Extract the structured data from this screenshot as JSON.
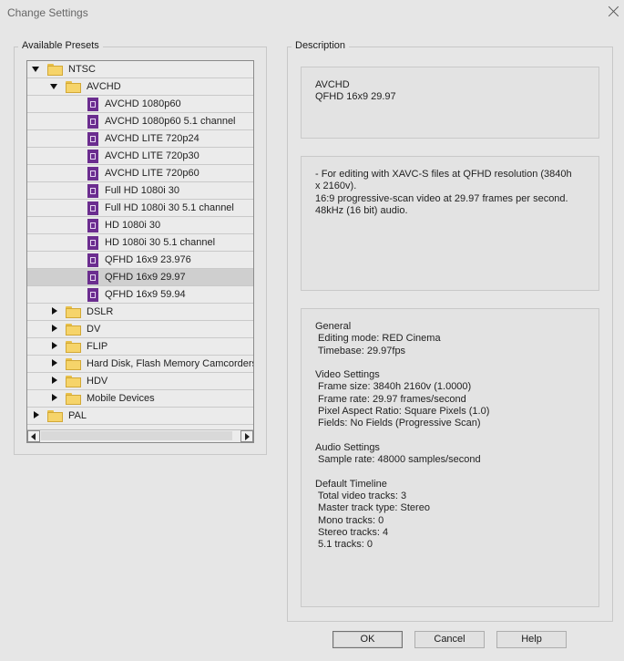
{
  "window": {
    "title": "Change Settings",
    "close_icon": "close-icon"
  },
  "presets_panel": {
    "label": "Available Presets",
    "tree": [
      {
        "label": "NTSC",
        "type": "folder",
        "arrow": "down",
        "indent": 0,
        "selected": false
      },
      {
        "label": "AVCHD",
        "type": "folder",
        "arrow": "down",
        "indent": 1,
        "selected": false
      },
      {
        "label": "AVCHD 1080p60",
        "type": "preset",
        "indent": 2,
        "selected": false
      },
      {
        "label": "AVCHD 1080p60 5.1 channel",
        "type": "preset",
        "indent": 2,
        "selected": false
      },
      {
        "label": "AVCHD LITE 720p24",
        "type": "preset",
        "indent": 2,
        "selected": false
      },
      {
        "label": "AVCHD LITE 720p30",
        "type": "preset",
        "indent": 2,
        "selected": false
      },
      {
        "label": "AVCHD LITE 720p60",
        "type": "preset",
        "indent": 2,
        "selected": false
      },
      {
        "label": "Full HD 1080i 30",
        "type": "preset",
        "indent": 2,
        "selected": false
      },
      {
        "label": "Full HD 1080i 30 5.1 channel",
        "type": "preset",
        "indent": 2,
        "selected": false
      },
      {
        "label": "HD 1080i 30",
        "type": "preset",
        "indent": 2,
        "selected": false
      },
      {
        "label": "HD 1080i 30 5.1 channel",
        "type": "preset",
        "indent": 2,
        "selected": false
      },
      {
        "label": "QFHD 16x9 23.976",
        "type": "preset",
        "indent": 2,
        "selected": false
      },
      {
        "label": "QFHD 16x9 29.97",
        "type": "preset",
        "indent": 2,
        "selected": true
      },
      {
        "label": "QFHD 16x9 59.94",
        "type": "preset",
        "indent": 2,
        "selected": false
      },
      {
        "label": "DSLR",
        "type": "folder",
        "arrow": "right",
        "indent": 1,
        "selected": false
      },
      {
        "label": "DV",
        "type": "folder",
        "arrow": "right",
        "indent": 1,
        "selected": false
      },
      {
        "label": "FLIP",
        "type": "folder",
        "arrow": "right",
        "indent": 1,
        "selected": false
      },
      {
        "label": "Hard Disk, Flash Memory Camcorders",
        "type": "folder",
        "arrow": "right",
        "indent": 1,
        "selected": false
      },
      {
        "label": "HDV",
        "type": "folder",
        "arrow": "right",
        "indent": 1,
        "selected": false
      },
      {
        "label": "Mobile Devices",
        "type": "folder",
        "arrow": "right",
        "indent": 1,
        "selected": false
      },
      {
        "label": "PAL",
        "type": "folder",
        "arrow": "right",
        "indent": 0,
        "selected": false
      }
    ]
  },
  "description_panel": {
    "label": "Description",
    "summary_lines": [
      "AVCHD",
      "QFHD 16x9 29.97"
    ],
    "details_lines": [
      "- For editing with XAVC-S files at QFHD resolution (3840h",
      "x 2160v).",
      "16:9 progressive-scan video at 29.97 frames per second.",
      "48kHz (16 bit) audio."
    ],
    "settings_lines": [
      "General",
      " Editing mode: RED Cinema",
      " Timebase: 29.97fps",
      "",
      "Video Settings",
      " Frame size: 3840h 2160v (1.0000)",
      " Frame rate: 29.97 frames/second",
      " Pixel Aspect Ratio: Square Pixels (1.0)",
      " Fields: No Fields (Progressive Scan)",
      "",
      "Audio Settings",
      " Sample rate: 48000 samples/second",
      "",
      "Default Timeline",
      " Total video tracks: 3",
      " Master track type: Stereo",
      " Mono tracks: 0",
      " Stereo tracks: 4",
      " 5.1 tracks: 0"
    ]
  },
  "buttons": {
    "ok": "OK",
    "cancel": "Cancel",
    "help": "Help"
  }
}
